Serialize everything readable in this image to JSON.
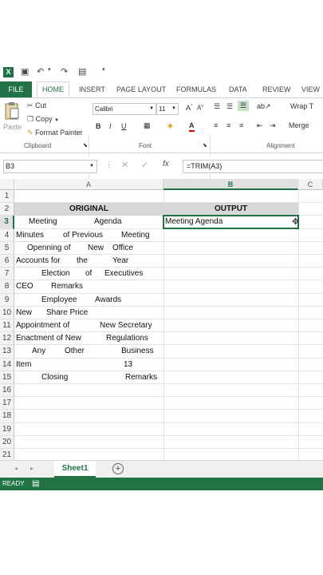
{
  "app": {
    "logo_text": "X"
  },
  "tabs": [
    "FILE",
    "HOME",
    "INSERT",
    "PAGE LAYOUT",
    "FORMULAS",
    "DATA",
    "REVIEW",
    "VIEW"
  ],
  "ribbon": {
    "clipboard": {
      "paste": "Paste",
      "cut": "Cut",
      "copy": "Copy",
      "format_painter": "Format Painter",
      "label": "Clipboard"
    },
    "font": {
      "name": "Calibri",
      "size": "11",
      "bold": "B",
      "italic": "I",
      "underline": "U",
      "label": "Font"
    },
    "alignment": {
      "wrap": "Wrap T",
      "merge": "Merge",
      "label": "Alignment"
    }
  },
  "formula_bar": {
    "name_box": "B3",
    "formula": "=TRIM(A3)",
    "fx": "fx"
  },
  "columns": [
    "A",
    "B",
    "C"
  ],
  "rows": [
    "1",
    "2",
    "3",
    "4",
    "5",
    "6",
    "7",
    "8",
    "9",
    "10",
    "11",
    "12",
    "13",
    "14",
    "15",
    "16",
    "17",
    "18",
    "19",
    "20",
    "21"
  ],
  "headers": {
    "a": "ORIGINAL",
    "b": "OUTPUT"
  },
  "cells_a": [
    [
      "Meeting",
      "Agenda"
    ],
    [
      "Minutes",
      "of Previous",
      "Meeting"
    ],
    [
      "Openning of",
      "New",
      "Office"
    ],
    [
      "Accounts for",
      "the",
      "Year"
    ],
    [
      "Election",
      "of",
      "Executives"
    ],
    [
      "CEO",
      "Remarks"
    ],
    [
      "Employee",
      "Awards"
    ],
    [
      "New",
      "Share Price"
    ],
    [
      "Appointment of",
      "New Secretary"
    ],
    [
      "Enactment of New",
      "Regulations"
    ],
    [
      "Any",
      "Other",
      "Business"
    ],
    [
      "Item",
      "13"
    ],
    [
      "Closing",
      "Remarks"
    ]
  ],
  "cell_b3": "Meeting Agenda",
  "sheet_tab": "Sheet1",
  "status": "READY",
  "colors": {
    "accent": "#217346"
  }
}
